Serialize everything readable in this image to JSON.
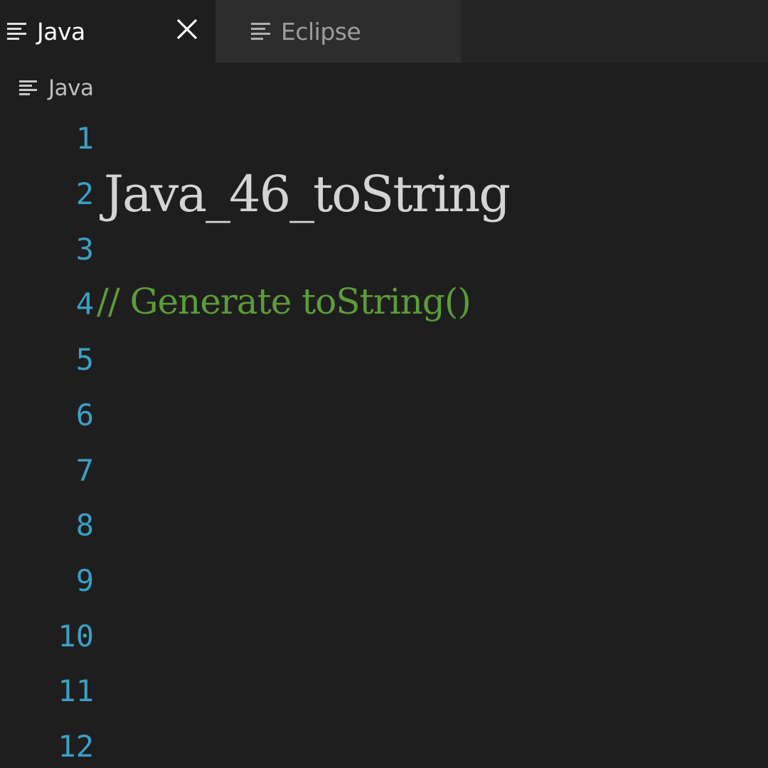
{
  "tabs": [
    {
      "label": "Java",
      "active": true,
      "icon": "lines-icon"
    },
    {
      "label": "Eclipse",
      "active": false,
      "icon": "lines-icon"
    }
  ],
  "breadcrumb": {
    "label": "Java",
    "icon": "lines-icon"
  },
  "editor": {
    "line_numbers": [
      "1",
      "2",
      "3",
      "4",
      "5",
      "6",
      "7",
      "8",
      "9",
      "10",
      "11",
      "12"
    ],
    "title_text": "Java_46_toString",
    "comment_text": "// Generate toString()"
  },
  "colors": {
    "background": "#1e1e1e",
    "line_number": "#3b9fc4",
    "comment": "#5c9c3a",
    "text": "#d4d4d4"
  }
}
